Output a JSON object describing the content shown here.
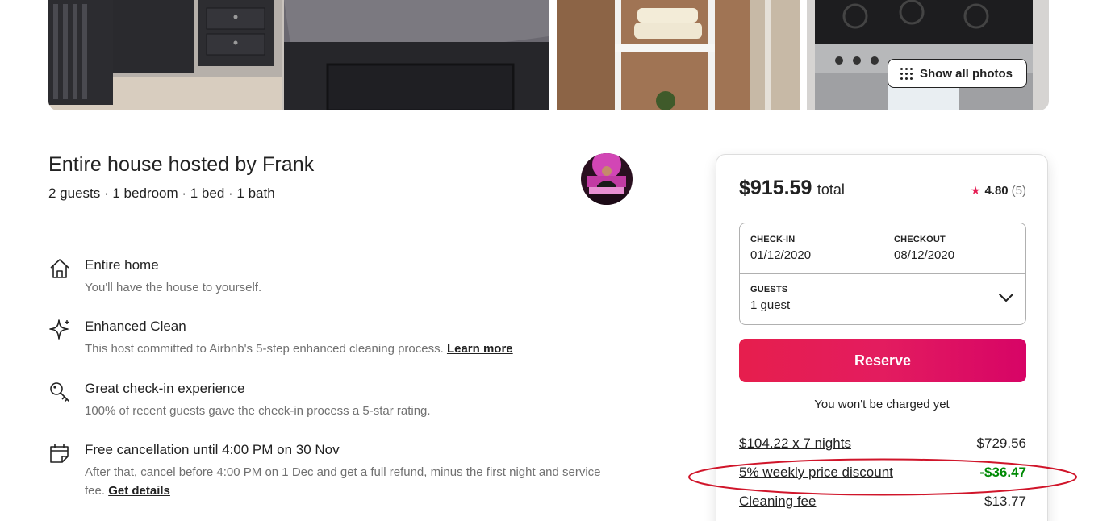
{
  "photos": {
    "show_all_label": "Show all photos"
  },
  "listing": {
    "title": "Entire house hosted by Frank",
    "subtitle": "2 guests · 1 bedroom · 1 bed · 1 bath"
  },
  "features": [
    {
      "icon": "house-icon",
      "title": "Entire home",
      "desc": "You'll have the house to yourself.",
      "link": ""
    },
    {
      "icon": "sparkle-icon",
      "title": "Enhanced Clean",
      "desc": "This host committed to Airbnb's 5-step enhanced cleaning process.",
      "link": "Learn more"
    },
    {
      "icon": "key-icon",
      "title": "Great check-in experience",
      "desc": "100% of recent guests gave the check-in process a 5-star rating.",
      "link": ""
    },
    {
      "icon": "calendar-icon",
      "title": "Free cancellation until 4:00 PM on 30 Nov",
      "desc": "After that, cancel before 4:00 PM on 1 Dec and get a full refund, minus the first night and service fee.",
      "link": "Get details"
    }
  ],
  "booking": {
    "price": "$915.59",
    "price_suffix": "total",
    "rating": "4.80",
    "review_count": "(5)",
    "checkin_label": "CHECK-IN",
    "checkin_value": "01/12/2020",
    "checkout_label": "CHECKOUT",
    "checkout_value": "08/12/2020",
    "guests_label": "GUESTS",
    "guests_value": "1 guest",
    "reserve_label": "Reserve",
    "no_charge_note": "You won't be charged yet",
    "lines": [
      {
        "label": "$104.22 x 7 nights",
        "amount": "$729.56"
      },
      {
        "label": "5% weekly price discount",
        "amount": "-$36.47"
      },
      {
        "label": "Cleaning fee",
        "amount": "$13.77"
      }
    ]
  },
  "colors": {
    "brand": "#E61E4D",
    "discount": "#008A05",
    "annotation": "#D0152A",
    "star": "#E51D53"
  }
}
